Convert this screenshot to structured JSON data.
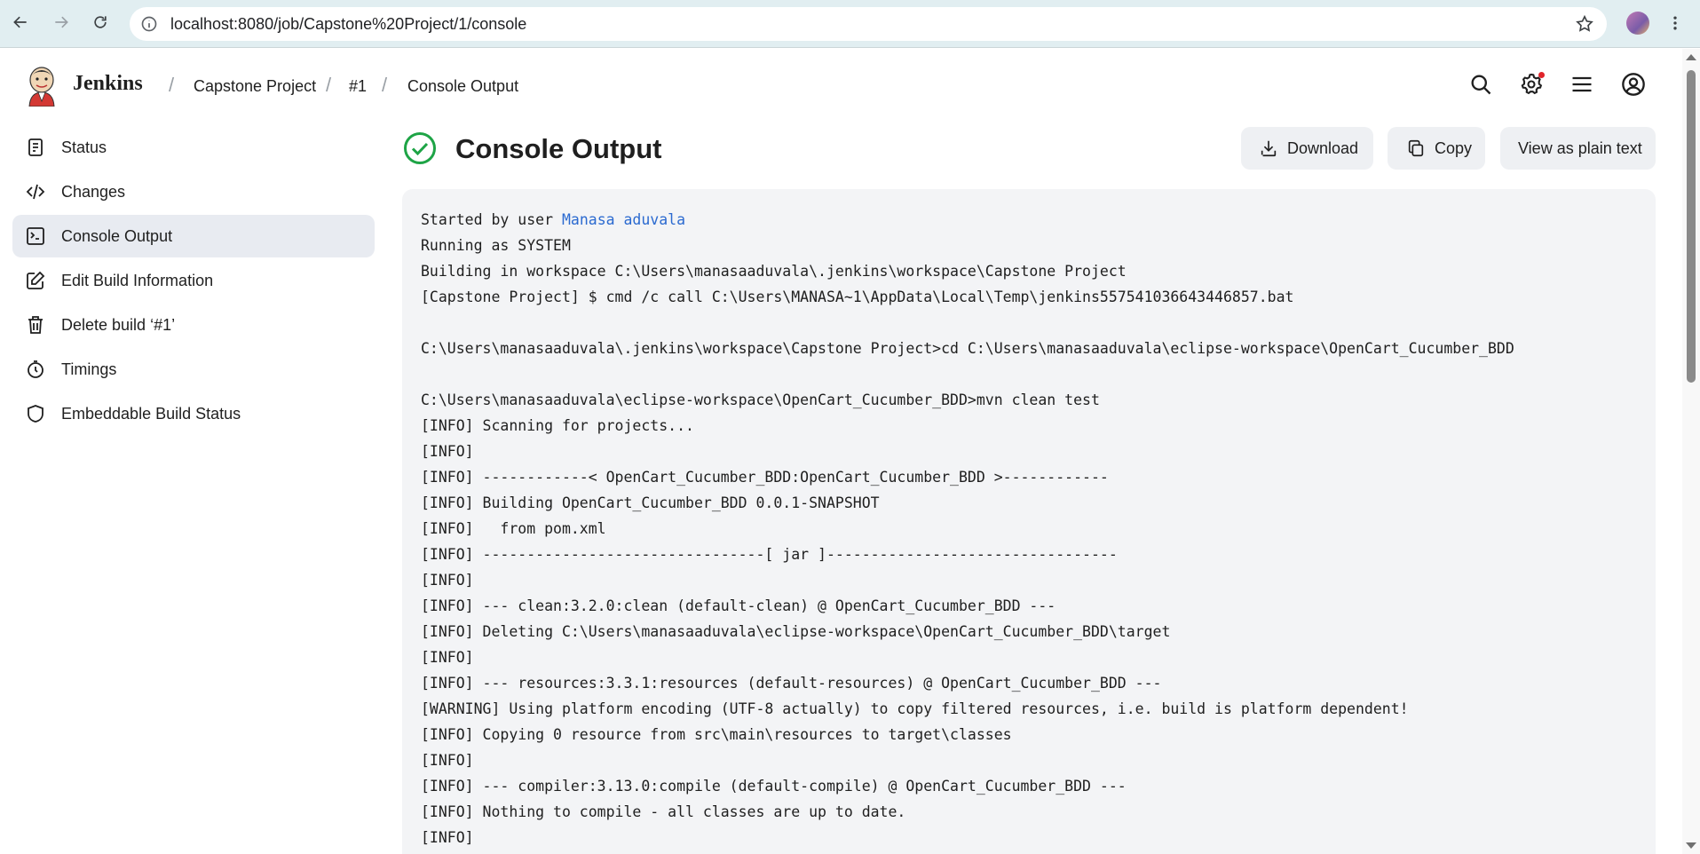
{
  "browser": {
    "url": "localhost:8080/job/Capstone%20Project/1/console",
    "icons": [
      "back-icon",
      "forward-icon",
      "reload-icon",
      "site-info-icon",
      "bookmark-star-icon",
      "profile-avatar",
      "browser-menu-icon"
    ]
  },
  "header": {
    "brand": "Jenkins",
    "breadcrumbs": [
      "Capstone Project",
      "#1",
      "Console Output"
    ],
    "separator": "/",
    "icons": [
      "search-icon",
      "gear-icon",
      "menu-lines-icon",
      "user-icon"
    ],
    "notification_color": "#e0242b"
  },
  "sidebar": {
    "items": [
      {
        "label": "Status",
        "icon": "document-icon"
      },
      {
        "label": "Changes",
        "icon": "code-icon"
      },
      {
        "label": "Console Output",
        "icon": "terminal-icon",
        "active": true
      },
      {
        "label": "Edit Build Information",
        "icon": "edit-icon"
      },
      {
        "label": "Delete build ‘#1’",
        "icon": "trash-icon"
      },
      {
        "label": "Timings",
        "icon": "stopwatch-icon"
      },
      {
        "label": "Embeddable Build Status",
        "icon": "shield-icon"
      }
    ]
  },
  "main": {
    "title": "Console Output",
    "status_icon": "success-check-icon",
    "status_color": "#1ea446",
    "actions": {
      "download": "Download",
      "copy": "Copy",
      "plain_text": "View as plain text"
    }
  },
  "console": {
    "started_prefix": "Started by user ",
    "user_link": "Manasa aduvala",
    "link_color": "#2b6ad0",
    "lines": [
      "Running as SYSTEM",
      "Building in workspace C:\\Users\\manasaaduvala\\.jenkins\\workspace\\Capstone Project",
      "[Capstone Project] $ cmd /c call C:\\Users\\MANASA~1\\AppData\\Local\\Temp\\jenkins557541036643446857.bat",
      "",
      "C:\\Users\\manasaaduvala\\.jenkins\\workspace\\Capstone Project>cd C:\\Users\\manasaaduvala\\eclipse-workspace\\OpenCart_Cucumber_BDD",
      "",
      "C:\\Users\\manasaaduvala\\eclipse-workspace\\OpenCart_Cucumber_BDD>mvn clean test",
      "[INFO] Scanning for projects...",
      "[INFO]",
      "[INFO] ------------< OpenCart_Cucumber_BDD:OpenCart_Cucumber_BDD >------------",
      "[INFO] Building OpenCart_Cucumber_BDD 0.0.1-SNAPSHOT",
      "[INFO]   from pom.xml",
      "[INFO] --------------------------------[ jar ]---------------------------------",
      "[INFO]",
      "[INFO] --- clean:3.2.0:clean (default-clean) @ OpenCart_Cucumber_BDD ---",
      "[INFO] Deleting C:\\Users\\manasaaduvala\\eclipse-workspace\\OpenCart_Cucumber_BDD\\target",
      "[INFO]",
      "[INFO] --- resources:3.3.1:resources (default-resources) @ OpenCart_Cucumber_BDD ---",
      "[WARNING] Using platform encoding (UTF-8 actually) to copy filtered resources, i.e. build is platform dependent!",
      "[INFO] Copying 0 resource from src\\main\\resources to target\\classes",
      "[INFO]",
      "[INFO] --- compiler:3.13.0:compile (default-compile) @ OpenCart_Cucumber_BDD ---",
      "[INFO] Nothing to compile - all classes are up to date.",
      "[INFO]"
    ]
  }
}
